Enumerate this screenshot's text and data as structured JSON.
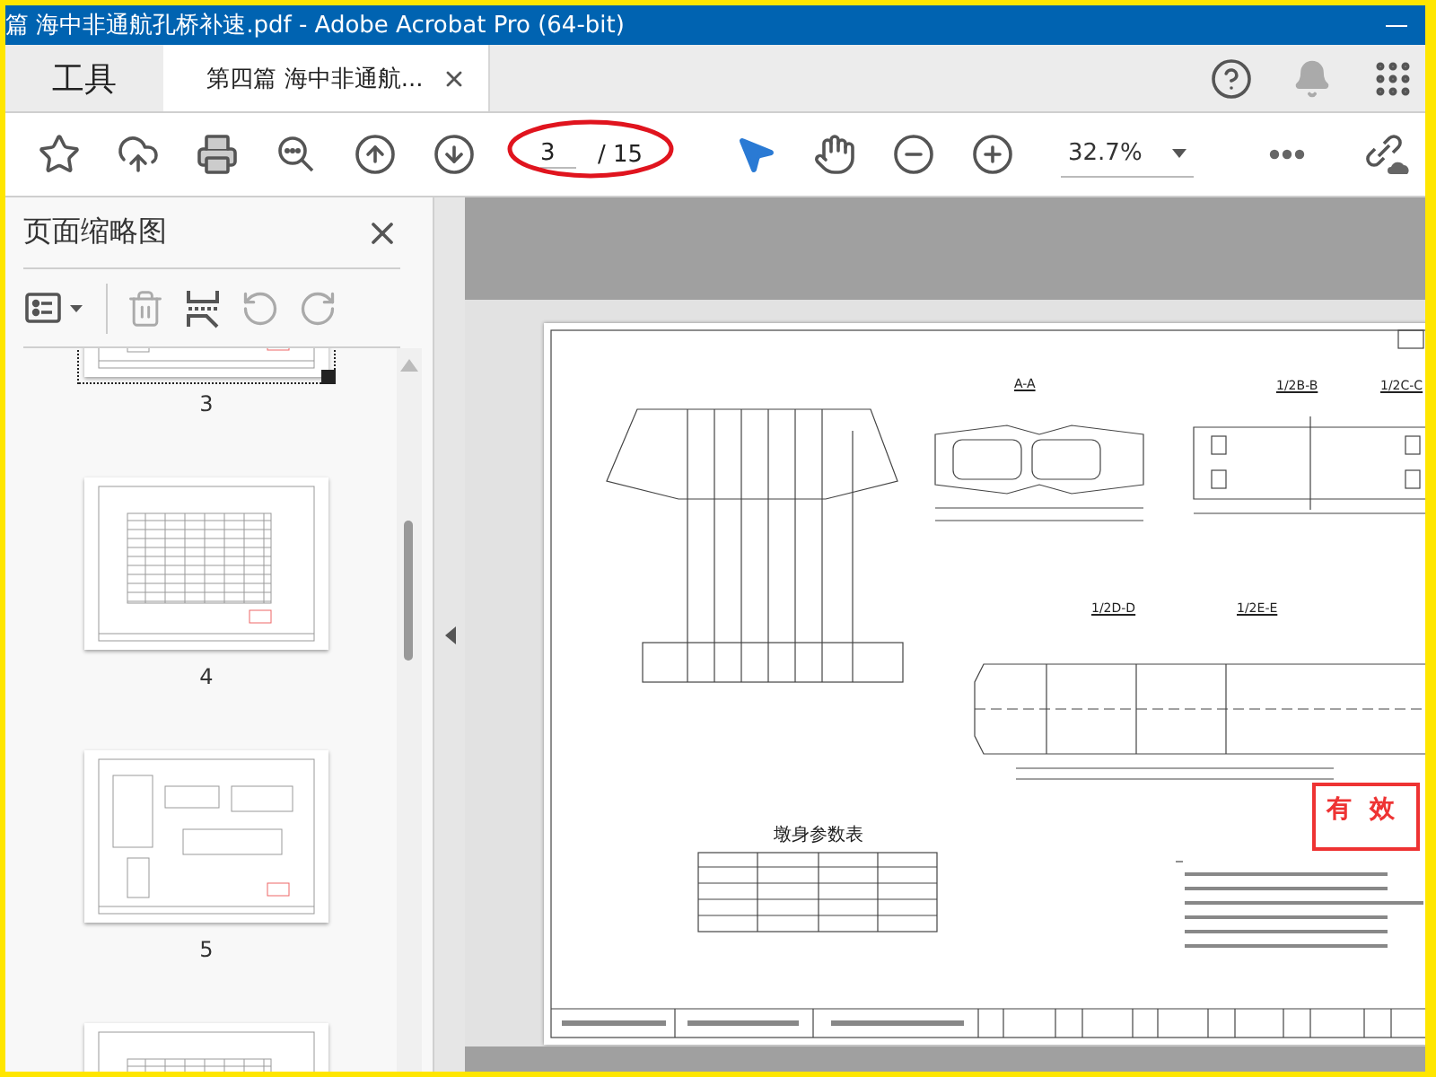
{
  "window": {
    "title": "篇 海中非通航孔桥补速.pdf - Adobe Acrobat Pro (64-bit)"
  },
  "tabs": [
    {
      "label": "工具",
      "selected": false,
      "closable": false
    },
    {
      "label": "第四篇 海中非通航...",
      "selected": true,
      "closable": true
    }
  ],
  "toolbar": {
    "page_current": "3",
    "page_total": "/ 15",
    "zoom": "32.7%"
  },
  "sidebar": {
    "title": "页面缩略图",
    "thumbnails": [
      {
        "label": "3",
        "kind": "drawing",
        "selected": true
      },
      {
        "label": "4",
        "kind": "table",
        "selected": false
      },
      {
        "label": "5",
        "kind": "drawing",
        "selected": false
      },
      {
        "kind": "table",
        "selected": false
      }
    ]
  },
  "document": {
    "sections": [
      "A-A",
      "1/2B-B",
      "1/2C-C",
      "1/2D-D",
      "1/2E-E"
    ],
    "table_title": "墩身参数表",
    "stamp": "有效"
  }
}
